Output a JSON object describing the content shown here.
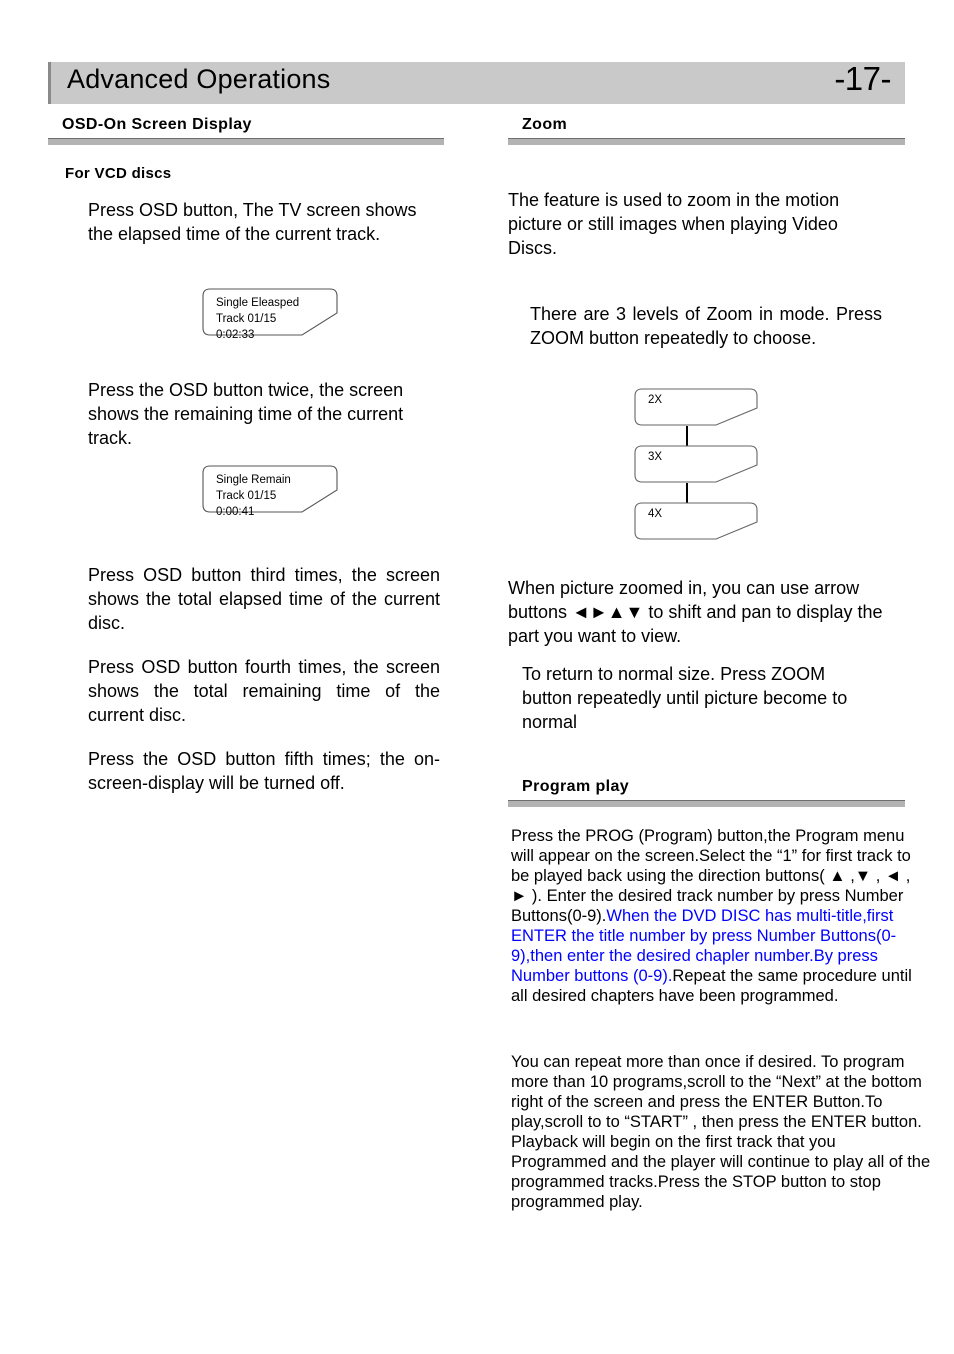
{
  "header": {
    "title": "Advanced Operations",
    "page_number": "-17-"
  },
  "left_column": {
    "section_title": "OSD-On Screen Display",
    "subhead": "For VCD discs",
    "paragraph_1": "Press OSD button, The TV screen shows the elapsed time of the current track.",
    "osd_box_1": {
      "line1": "Single  Eleasped",
      "line2": "Track  01/15",
      "line3": "0:02:33"
    },
    "paragraph_2": "Press the OSD button twice, the screen shows the remaining time of the current track.",
    "osd_box_2": {
      "line1": "Single  Remain",
      "line2": "Track  01/15",
      "line3": "0:00:41"
    },
    "paragraph_3": "Press  OSD  button  third  times, the screen shows the total elapsed time of the current disc.",
    "paragraph_4": "Press  OSD  button  fourth times, the screen shows the total remaining time of the current disc.",
    "paragraph_5": "Press the OSD button fifth times; the  on-screen-display  will  be turned off."
  },
  "right_column": {
    "zoom_section_title": "Zoom",
    "zoom_paragraph_1": "The feature is used to zoom in the motion picture or still images when playing Video Discs.",
    "zoom_paragraph_2": "There are 3 levels of Zoom in mode. Press  ZOOM  button  repeatedly to choose.",
    "zoom_levels": [
      "2X",
      "3X",
      "4X"
    ],
    "zoom_paragraph_3_a": "When picture zoomed in, you can use arrow buttons ",
    "zoom_paragraph_3_arrows": "◄►▲▼",
    "zoom_paragraph_3_b": " to shift and pan to display the part you want to view.",
    "zoom_paragraph_4": "To return to normal size. Press ZOOM  button repeatedly until picture become to normal",
    "program_section_title": "Program play",
    "program_paragraph_1_black_a": "Press the PROG (Program) button,the Program menu will appear on the screen.Select the  “1” for first track to be played back using the direction buttons( ▲ ,▼ , ◄ , ► ). Enter the desired track number by press Number Buttons(0-9).",
    "program_paragraph_1_blue": "When the DVD DISC has multi-title,first ENTER the title number by press Number Buttons(0-9),then enter the desired chapler number.By press Number buttons (0-9).",
    "program_paragraph_1_black_b": "Repeat the same procedure until all desired chapters have been programmed.",
    "program_paragraph_2": "You can repeat more than once if desired. To program more than 10 programs,scroll to the  “Next” at the bottom right of the screen and press the ENTER Button.To play,scroll to to  “START” , then press the ENTER button. Playback will begin on the first track that you Programmed and the player will continue to play all of the programmed tracks.Press the STOP button to stop programmed play."
  },
  "colors": {
    "header_bar": "#c9c9c9",
    "rule_bar": "#b3b3b3",
    "blue_text": "#0000ff"
  }
}
